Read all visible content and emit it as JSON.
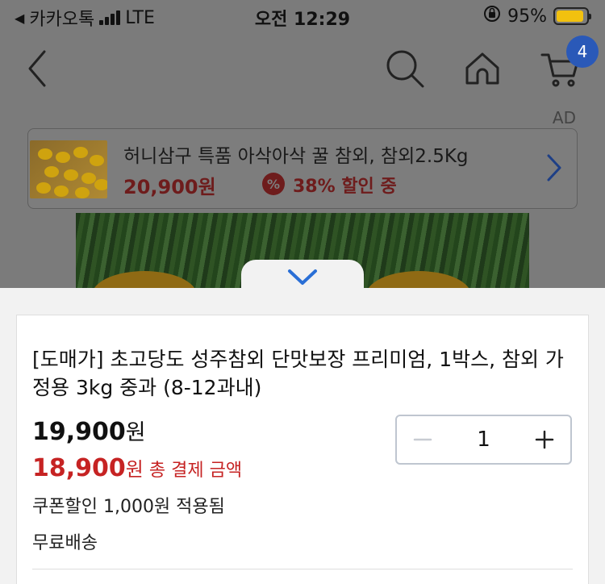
{
  "status_bar": {
    "carrier": "카카오톡",
    "network": "LTE",
    "time": "오전 12:29",
    "battery": "95%"
  },
  "header": {
    "cart_count": "4",
    "icons": [
      "back-icon",
      "search-icon",
      "home-icon",
      "cart-icon"
    ]
  },
  "ad": {
    "label": "AD",
    "title": "허니삼구 특품 아삭아삭 꿀 참외, 참외2.5Kg",
    "price": "20,900원",
    "discount_badge": "%",
    "discount_text": "38% 할인 중"
  },
  "product": {
    "title": "[도매가] 초고당도 성주참외 단맛보장 프리미엄, 1박스, 참외 가정용 3kg 중과 (8-12과내)",
    "original_price": "19,900",
    "original_unit": "원",
    "final_price": "18,900",
    "final_unit": "원",
    "final_label": "총 결제 금액",
    "coupon_text": "쿠폰할인 1,000원 적용됨",
    "shipping_text": "무료배송",
    "quantity": "1"
  },
  "colors": {
    "accent_blue": "#2a59b8",
    "price_red": "#c62323",
    "overlay_gray": "#7b7b7b"
  }
}
